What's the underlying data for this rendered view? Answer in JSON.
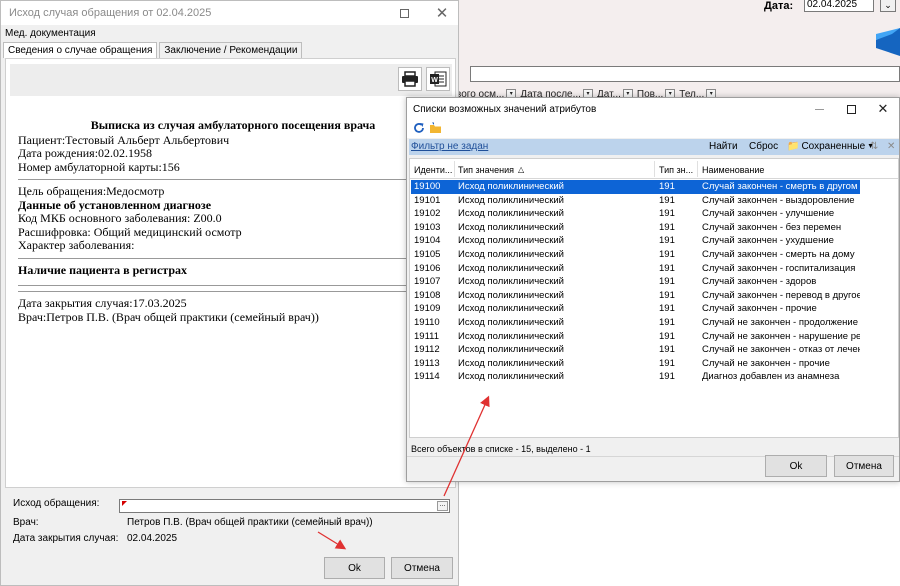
{
  "background": {
    "date_label": "Дата:",
    "date_value": "02.04.2025",
    "columns": [
      "вого осм...",
      "Дата после...",
      "Дат...",
      "Пов...",
      "Тел..."
    ]
  },
  "main_window": {
    "title": "Исход случая обращения от 02.04.2025",
    "menu": "Мед. документация",
    "tabs": [
      "Сведения о случае обращения",
      "Заключение / Рекомендации"
    ],
    "document": {
      "heading": "Выписка из случая амбулаторного посещения врача",
      "patient": "Пациент:Тестовый Альберт Альбертович",
      "birthdate": "Дата рождения:02.02.1958",
      "card_number": "Номер амбулаторной карты:156",
      "purpose": "Цель обращения:Медосмотр",
      "diagnosis_heading": "Данные об установленном диагнозе",
      "mkb_code": "Код МКБ основного заболевания: Z00.0",
      "decoding": "Расшифровка: Общий медицинский осмотр",
      "disease_character": "Характер заболевания:",
      "registry_heading": "Наличие пациента в регистрах",
      "close_date": "Дата закрытия случая:17.03.2025",
      "doctor": "Врач:Петров П.В. (Врач общей практики (семейный врач))"
    },
    "form": {
      "outcome_label": "Исход обращения:",
      "outcome_value": "",
      "doctor_label": "Врач:",
      "doctor_value": "Петров П.В. (Врач общей практики (семейный врач))",
      "close_date_label": "Дата закрытия случая:",
      "close_date_value": "02.04.2025"
    },
    "ok_label": "Ok",
    "cancel_label": "Отмена"
  },
  "dialog": {
    "title": "Списки возможных значений атрибутов",
    "filter_link": "Фильтр не задан",
    "find_label": "Найти",
    "reset_label": "Сброс",
    "saved_label": "Сохраненные",
    "columns": [
      "Иденти...",
      "Тип значения",
      "Тип зн...",
      "Наименование"
    ],
    "rows": [
      {
        "id": "19100",
        "type": "Исход поликлинический",
        "code": "191",
        "name": "Случай закончен - смерть в другом ...",
        "selected": true
      },
      {
        "id": "19101",
        "type": "Исход поликлинический",
        "code": "191",
        "name": "Случай закончен - выздоровление"
      },
      {
        "id": "19102",
        "type": "Исход поликлинический",
        "code": "191",
        "name": "Случай закончен - улучшение"
      },
      {
        "id": "19103",
        "type": "Исход поликлинический",
        "code": "191",
        "name": "Случай закончен - без перемен"
      },
      {
        "id": "19104",
        "type": "Исход поликлинический",
        "code": "191",
        "name": "Случай закончен - ухудшение"
      },
      {
        "id": "19105",
        "type": "Исход поликлинический",
        "code": "191",
        "name": "Случай закончен - смерть на дому"
      },
      {
        "id": "19106",
        "type": "Исход поликлинический",
        "code": "191",
        "name": "Случай закончен - госпитализация"
      },
      {
        "id": "19107",
        "type": "Исход поликлинический",
        "code": "191",
        "name": "Случай закончен - здоров"
      },
      {
        "id": "19108",
        "type": "Исход поликлинический",
        "code": "191",
        "name": "Случай закончен - перевод в другое ..."
      },
      {
        "id": "19109",
        "type": "Исход поликлинический",
        "code": "191",
        "name": "Случай закончен - прочие"
      },
      {
        "id": "19110",
        "type": "Исход поликлинический",
        "code": "191",
        "name": "Случай не закончен - продолжение ..."
      },
      {
        "id": "19111",
        "type": "Исход поликлинический",
        "code": "191",
        "name": "Случай не закончен - нарушение ре..."
      },
      {
        "id": "19112",
        "type": "Исход поликлинический",
        "code": "191",
        "name": "Случай не закончен - отказ от лечен..."
      },
      {
        "id": "19113",
        "type": "Исход поликлинический",
        "code": "191",
        "name": "Случай не закончен - прочие"
      },
      {
        "id": "19114",
        "type": "Исход поликлинический",
        "code": "191",
        "name": "Диагноз добавлен из анамнеза"
      }
    ],
    "status": "Всего объектов в списке - 15, выделено - 1",
    "ok_label": "Ok",
    "cancel_label": "Отмена"
  },
  "colors": {
    "selection": "#0d64d6",
    "filter_bar": "#bcd3ec",
    "annotation_arrow": "#e03131"
  }
}
